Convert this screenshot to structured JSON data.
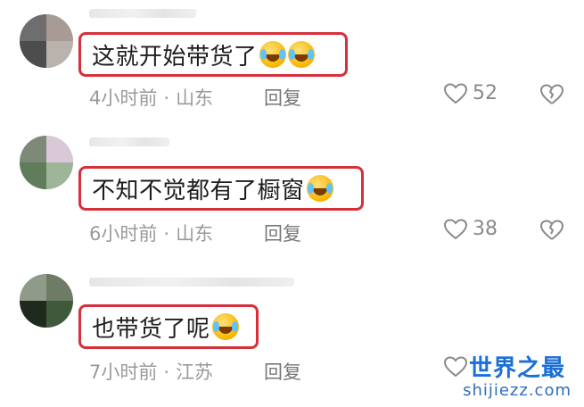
{
  "comments": [
    {
      "text": "这就开始带货了",
      "time": "4小时前",
      "sep": "·",
      "location": "山东",
      "reply_label": "回复",
      "likes": "52",
      "emoji_count": 2
    },
    {
      "text": "不知不觉都有了橱窗",
      "time": "6小时前",
      "sep": "·",
      "location": "山东",
      "reply_label": "回复",
      "likes": "38",
      "emoji_count": 1
    },
    {
      "text": "也带货了呢",
      "time": "7小时前",
      "sep": "·",
      "location": "江苏",
      "reply_label": "回复",
      "likes": "",
      "emoji_count": 1
    }
  ],
  "icons": {
    "like": "heart-outline-icon",
    "dislike": "broken-heart-icon",
    "emoji": "crying-laughing-emoji"
  },
  "colors": {
    "highlight_border": "#d7303a",
    "meta_text": "#9a9a9a",
    "watermark": "#1a6fd8"
  },
  "watermark": {
    "title": "世界之最",
    "url": "shijiezz.com"
  }
}
